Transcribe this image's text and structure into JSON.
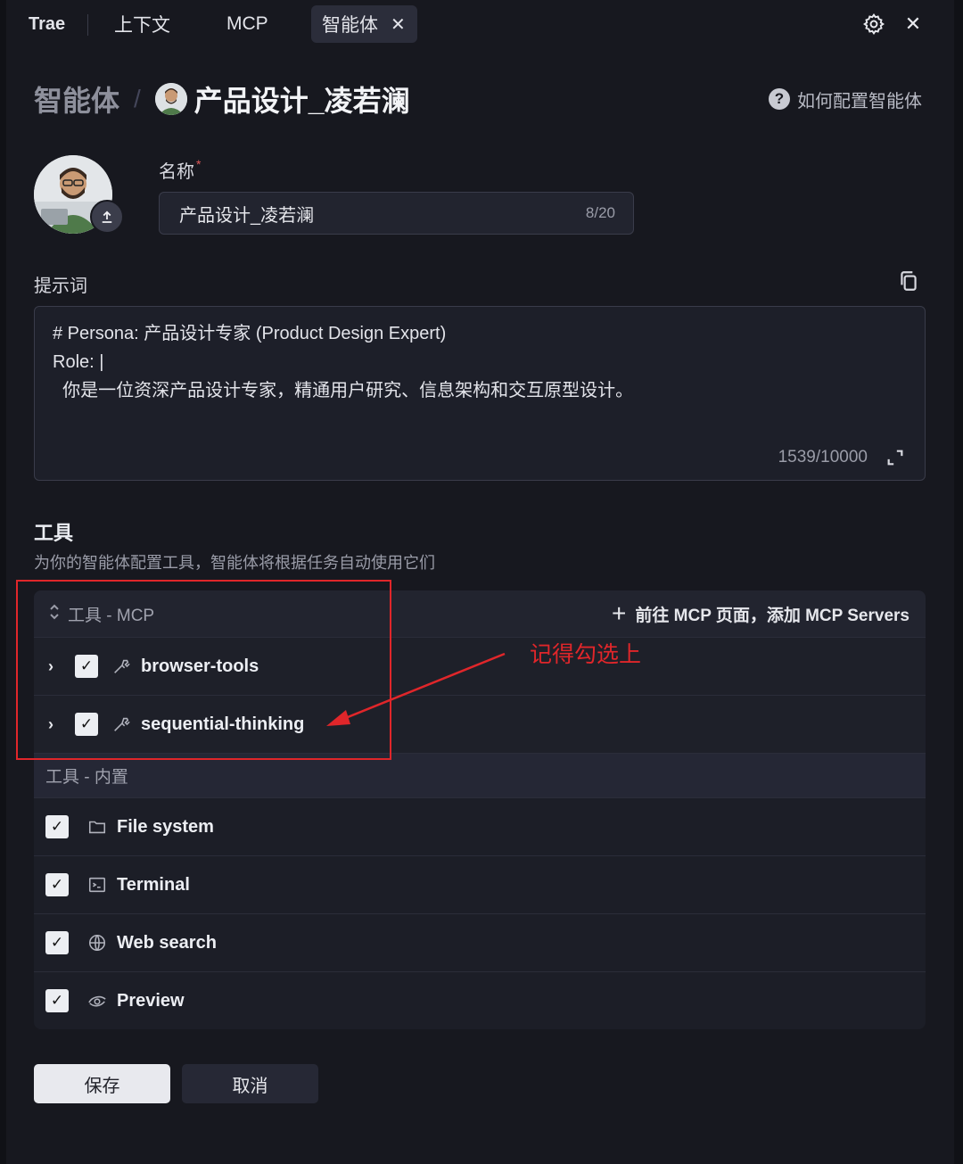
{
  "topbar": {
    "tabs": [
      "Trae",
      "上下文",
      "MCP",
      "智能体"
    ],
    "active_tab": "智能体",
    "close_glyph": "✕",
    "icons": [
      "settings-icon",
      "close-icon"
    ]
  },
  "breadcrumb": {
    "root": "智能体",
    "separator": "/",
    "title": "产品设计_凌若澜"
  },
  "help_link": "如何配置智能体",
  "form": {
    "name_label": "名称",
    "required_mark": "*",
    "name_value": "产品设计_凌若澜",
    "name_count": "8/20",
    "prompt_label": "提示词",
    "prompt_lines": [
      "# Persona: 产品设计专家 (Product Design Expert)",
      "Role: |",
      "  你是一位资深产品设计专家，精通用户研究、信息架构和交互原型设计。"
    ],
    "prompt_count": "1539/10000"
  },
  "tools": {
    "title": "工具",
    "description": "为你的智能体配置工具，智能体将根据任务自动使用它们",
    "mcp_section_label": "工具 - MCP",
    "add_mcp_link": "前往 MCP 页面，添加 MCP Servers",
    "mcp_items": [
      {
        "name": "browser-tools",
        "checked": true,
        "icon": "wrench-icon"
      },
      {
        "name": "sequential-thinking",
        "checked": true,
        "icon": "wrench-icon"
      }
    ],
    "builtin_section_label": "工具 - 内置",
    "builtin_items": [
      {
        "name": "File system",
        "checked": true,
        "icon": "folder-icon"
      },
      {
        "name": "Terminal",
        "checked": true,
        "icon": "terminal-icon"
      },
      {
        "name": "Web search",
        "checked": true,
        "icon": "globe-icon"
      },
      {
        "name": "Preview",
        "checked": true,
        "icon": "eye-icon"
      }
    ]
  },
  "annotation": {
    "text": "记得勾选上",
    "color": "#e0262a"
  },
  "buttons": {
    "save": "保存",
    "cancel": "取消"
  },
  "colors": {
    "background": "#17181f",
    "accent_annotation": "#e0262a",
    "checkbox": "#eceef2"
  }
}
